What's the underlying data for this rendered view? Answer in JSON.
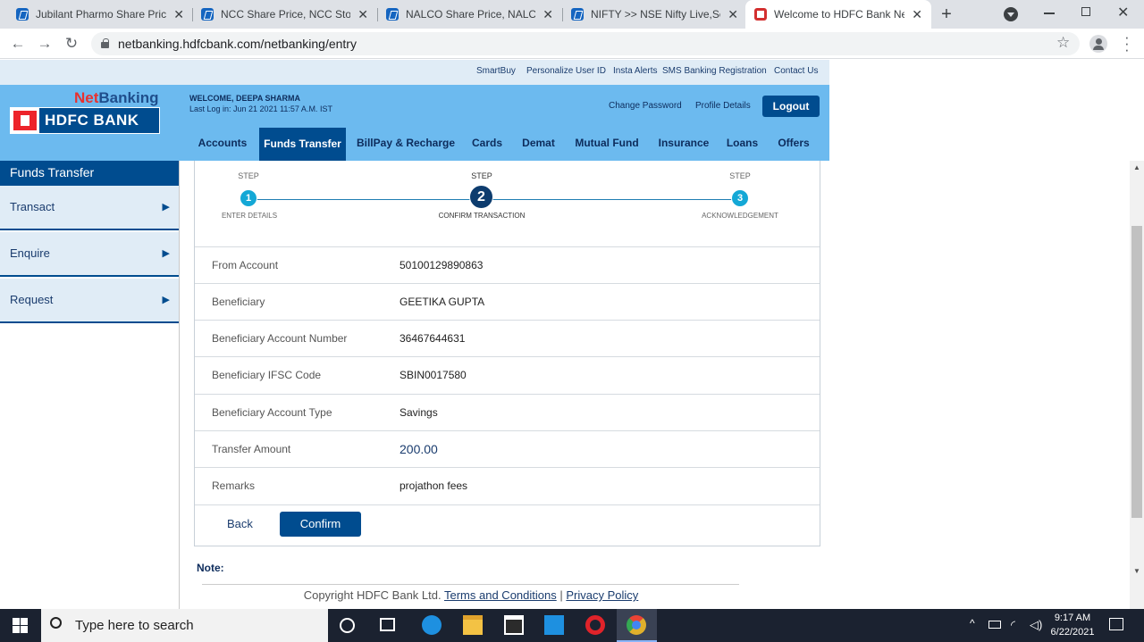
{
  "browser": {
    "tabs": [
      {
        "title": "Jubilant Pharmo Share Price,",
        "active": false
      },
      {
        "title": "NCC Share Price, NCC Stock P",
        "active": false
      },
      {
        "title": "NALCO Share Price, NALCO St",
        "active": false
      },
      {
        "title": "NIFTY >> NSE Nifty Live,Sens",
        "active": false
      },
      {
        "title": "Welcome to HDFC Bank NetB",
        "active": true
      }
    ],
    "new_tab_label": "+",
    "url": "netbanking.hdfcbank.com/netbanking/entry"
  },
  "top_links": [
    "SmartBuy",
    "Personalize User ID",
    "Insta Alerts",
    "SMS Banking Registration",
    "Contact Us"
  ],
  "header": {
    "netbanking_net": "Net",
    "netbanking_banking": "Banking",
    "bank_name": "HDFC BANK",
    "welcome": "WELCOME, DEEPA SHARMA",
    "last_login": "Last Log in: Jun 21 2021 11:57 A.M. IST",
    "change_password": "Change Password",
    "profile_details": "Profile Details",
    "logout": "Logout"
  },
  "menu": [
    {
      "label": "Accounts",
      "active": false
    },
    {
      "label": "Funds Transfer",
      "active": true
    },
    {
      "label": "BillPay & Recharge",
      "active": false
    },
    {
      "label": "Cards",
      "active": false
    },
    {
      "label": "Demat",
      "active": false
    },
    {
      "label": "Mutual Fund",
      "active": false
    },
    {
      "label": "Insurance",
      "active": false
    },
    {
      "label": "Loans",
      "active": false
    },
    {
      "label": "Offers",
      "active": false
    }
  ],
  "sidebar": {
    "title": "Funds Transfer",
    "items": [
      {
        "label": "Transact"
      },
      {
        "label": "Enquire"
      },
      {
        "label": "Request"
      }
    ]
  },
  "steps": [
    {
      "label": "STEP",
      "number": "1",
      "caption": "ENTER DETAILS",
      "current": false
    },
    {
      "label": "STEP",
      "number": "2",
      "caption": "CONFIRM TRANSACTION",
      "current": true
    },
    {
      "label": "STEP",
      "number": "3",
      "caption": "ACKNOWLEDGEMENT",
      "current": false
    }
  ],
  "details": [
    {
      "label": "From Account",
      "value": "50100129890863"
    },
    {
      "label": "Beneficiary",
      "value": "GEETIKA GUPTA"
    },
    {
      "label": "Beneficiary Account Number",
      "value": "36467644631"
    },
    {
      "label": "Beneficiary IFSC Code",
      "value": "SBIN0017580"
    },
    {
      "label": "Beneficiary Account Type",
      "value": "Savings"
    },
    {
      "label": "Transfer Amount",
      "value": "200.00"
    },
    {
      "label": "Remarks",
      "value": "projathon fees"
    }
  ],
  "actions": {
    "back": "Back",
    "confirm": "Confirm"
  },
  "note": "Note:",
  "footer": {
    "copyright": "Copyright HDFC Bank Ltd.",
    "terms": "Terms and Conditions",
    "separator": "|",
    "privacy": "Privacy Policy"
  },
  "taskbar": {
    "search_placeholder": "Type here to search",
    "time": "9:17 AM",
    "date": "6/22/2021"
  },
  "colors": {
    "brand_blue": "#004c8f",
    "header_blue": "#6cbaef",
    "hdfc_red": "#ed232a",
    "step_blue": "#14a8d6"
  }
}
